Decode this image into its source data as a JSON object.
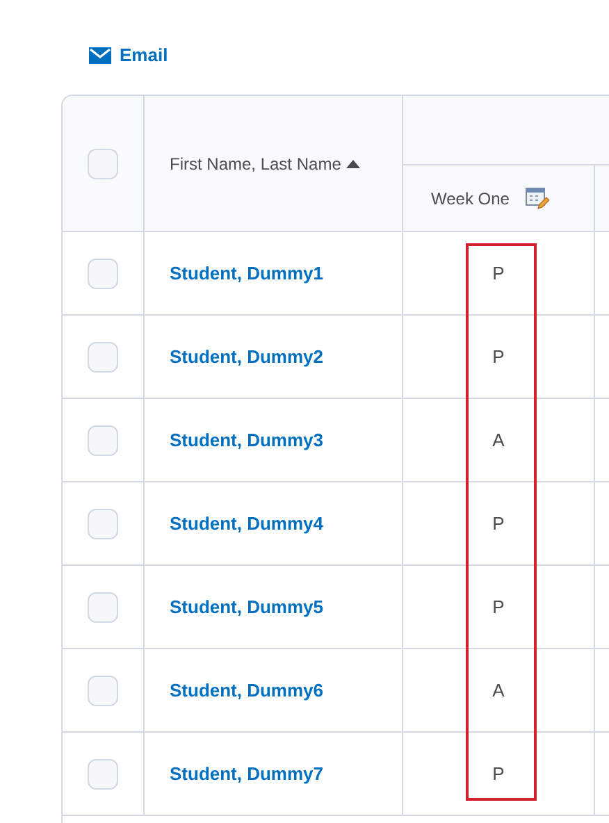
{
  "toolbar": {
    "email_label": "Email"
  },
  "table": {
    "select_all": {
      "checked": false
    },
    "name_column": "First Name, Last Name",
    "name_sorted_ascending": true,
    "grade_column": "Week One",
    "rows": [
      {
        "checked": false,
        "name": "Student, Dummy1",
        "grade": "P"
      },
      {
        "checked": false,
        "name": "Student, Dummy2",
        "grade": "P"
      },
      {
        "checked": false,
        "name": "Student, Dummy3",
        "grade": "A"
      },
      {
        "checked": false,
        "name": "Student, Dummy4",
        "grade": "P"
      },
      {
        "checked": false,
        "name": "Student, Dummy5",
        "grade": "P"
      },
      {
        "checked": false,
        "name": "Student, Dummy6",
        "grade": "A"
      },
      {
        "checked": false,
        "name": "Student, Dummy7",
        "grade": "P"
      }
    ],
    "highlight": {
      "on": true
    }
  }
}
